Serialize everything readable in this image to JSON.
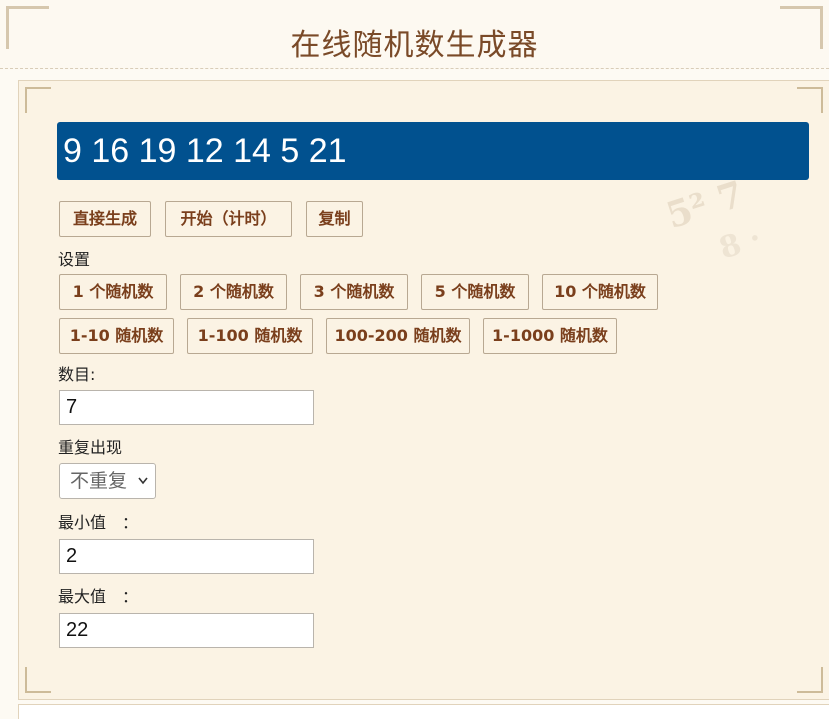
{
  "header": {
    "title": "在线随机数生成器"
  },
  "result": {
    "text": "9 16 19 12 14 5 21"
  },
  "actions": [
    {
      "label": "直接生成"
    },
    {
      "label": "开始（计时）"
    },
    {
      "label": "复制"
    }
  ],
  "settings": {
    "heading": "设置",
    "count_presets": [
      "1 个随机数",
      "2 个随机数",
      "3 个随机数",
      "5 个随机数",
      "10 个随机数"
    ],
    "range_presets": [
      "1-10 随机数",
      "1-100 随机数",
      "100-200 随机数",
      "1-1000 随机数"
    ]
  },
  "form": {
    "count_label": "数目:",
    "count_value": "7",
    "repeat_label": "重复出现",
    "repeat_value": "不重复",
    "min_label": "最小值　：",
    "min_value": "2",
    "max_label": "最大值　：",
    "max_value": "22"
  }
}
